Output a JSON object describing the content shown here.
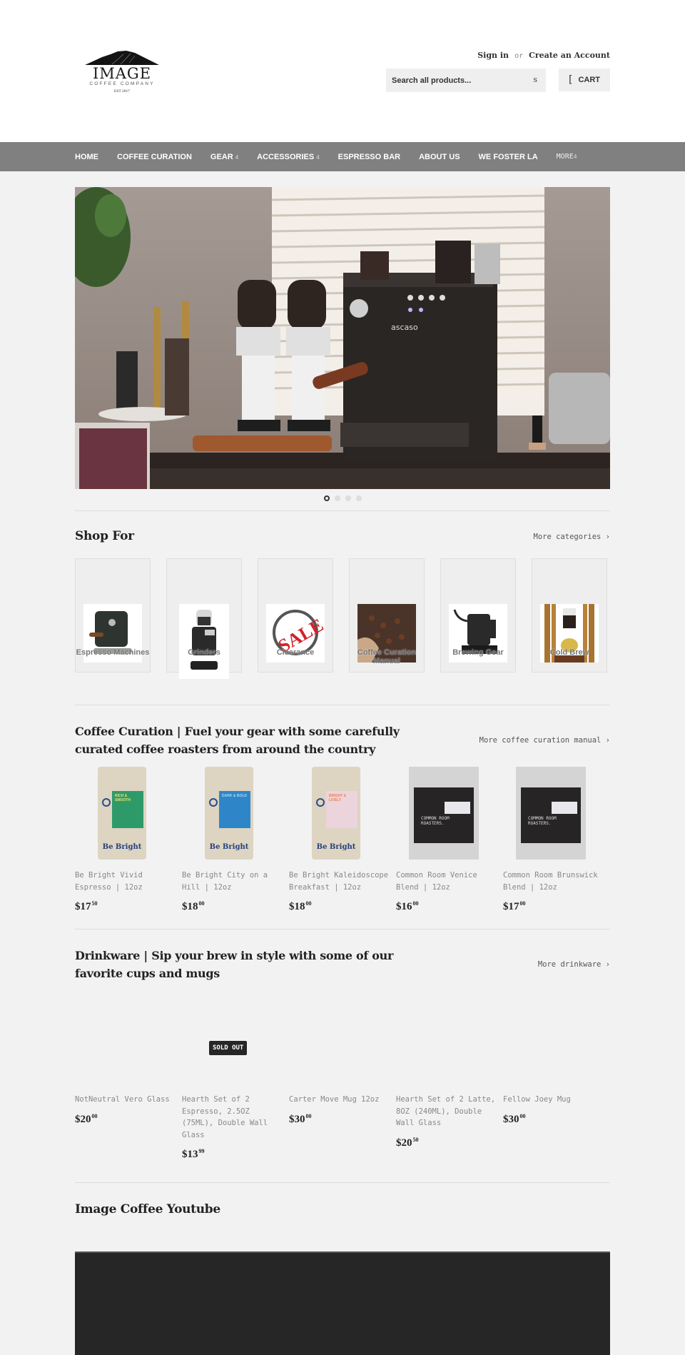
{
  "header": {
    "logo": {
      "title": "IMAGE",
      "subtitle": "COFFEE COMPANY",
      "est": "EST 2017"
    },
    "account": {
      "sign_in": "Sign in",
      "or": "or",
      "create": "Create an Account"
    },
    "search": {
      "placeholder": "Search all products...",
      "icon_glyph": "s",
      "icon": "search-icon"
    },
    "cart": {
      "icon_glyph": "[",
      "icon": "cart-icon",
      "label": "CART"
    }
  },
  "nav": {
    "items": [
      {
        "label": "HOME",
        "has_dropdown": false
      },
      {
        "label": "COFFEE CURATION",
        "has_dropdown": false
      },
      {
        "label": "GEAR",
        "has_dropdown": true,
        "caret": "4"
      },
      {
        "label": "ACCESSORIES",
        "has_dropdown": true,
        "caret": "4"
      },
      {
        "label": "ESPRESSO BAR",
        "has_dropdown": false
      },
      {
        "label": "ABOUT US",
        "has_dropdown": false
      },
      {
        "label": "WE FOSTER LA",
        "has_dropdown": false
      },
      {
        "label": "MORE",
        "has_dropdown": true,
        "caret": "4"
      }
    ]
  },
  "hero": {
    "alt": "Espresso bar with ascaso espresso machine and two grinders",
    "machine_brand": "ascaso",
    "slides_total": 4,
    "active_slide": 1
  },
  "shop_for": {
    "title": "Shop For",
    "more_link": "More categories ›",
    "categories": [
      {
        "label": "Espresso Machines"
      },
      {
        "label": "Grinders"
      },
      {
        "label": "Clearance"
      },
      {
        "label": "Coffee Curation Manual"
      },
      {
        "label": "Brewing Gear"
      },
      {
        "label": "Cold Brew"
      }
    ]
  },
  "coffee_curation": {
    "title": "Coffee Curation | Fuel your gear with some carefully curated coffee roasters from around the country",
    "more_link": "More coffee curation manual ›",
    "products": [
      {
        "name": "Be Bright Vivid Espresso | 12oz",
        "price_main": "$17",
        "price_cents": "50",
        "bag_label": "RICH & SMOOTH",
        "bag_color": "#2e9a6a",
        "label_text_color": "#e8e070"
      },
      {
        "name": "Be Bright City on a Hill | 12oz",
        "price_main": "$18",
        "price_cents": "00",
        "bag_label": "DARK & BOLD",
        "bag_color": "#2e86c8",
        "label_text_color": "#a8d8f0"
      },
      {
        "name": "Be Bright Kaleidoscope Breakfast | 12oz",
        "price_main": "$18",
        "price_cents": "00",
        "bag_label": "BRIGHT & LIVELY",
        "bag_color": "#ecd4dc",
        "label_text_color": "#f08050"
      },
      {
        "name": "Common Room Venice Blend | 12oz",
        "price_main": "$16",
        "price_cents": "00",
        "box_text": "COMMON ROOM ROASTERS."
      },
      {
        "name": "Common Room Brunswick Blend | 12oz",
        "price_main": "$17",
        "price_cents": "00",
        "box_text": "COMMON ROOM ROASTERS."
      }
    ],
    "bag_brand": "Be Bright"
  },
  "drinkware": {
    "title": "Drinkware | Sip your brew in style with some of our favorite cups and mugs",
    "more_link": "More drinkware ›",
    "products": [
      {
        "name": "NotNeutral Vero Glass",
        "price_main": "$20",
        "price_cents": "00",
        "sold_out": false
      },
      {
        "name": "Hearth Set of 2 Espresso, 2.5OZ (75ML), Double Wall Glass",
        "price_main": "$13",
        "price_cents": "99",
        "sold_out": true
      },
      {
        "name": "Carter Move Mug 12oz",
        "price_main": "$30",
        "price_cents": "00",
        "sold_out": false
      },
      {
        "name": "Hearth Set of 2 Latte, 8OZ (240ML), Double Wall Glass",
        "price_main": "$20",
        "price_cents": "50",
        "sold_out": false
      },
      {
        "name": "Fellow Joey Mug",
        "price_main": "$30",
        "price_cents": "00",
        "sold_out": false
      }
    ],
    "sold_out_label": "SOLD OUT"
  },
  "youtube": {
    "title": "Image Coffee Youtube"
  },
  "colors": {
    "page_bg": "#f2f2f2",
    "nav_bg": "#808080",
    "video_bg": "#262626",
    "text_dark": "#222222",
    "text_muted": "#888888"
  }
}
